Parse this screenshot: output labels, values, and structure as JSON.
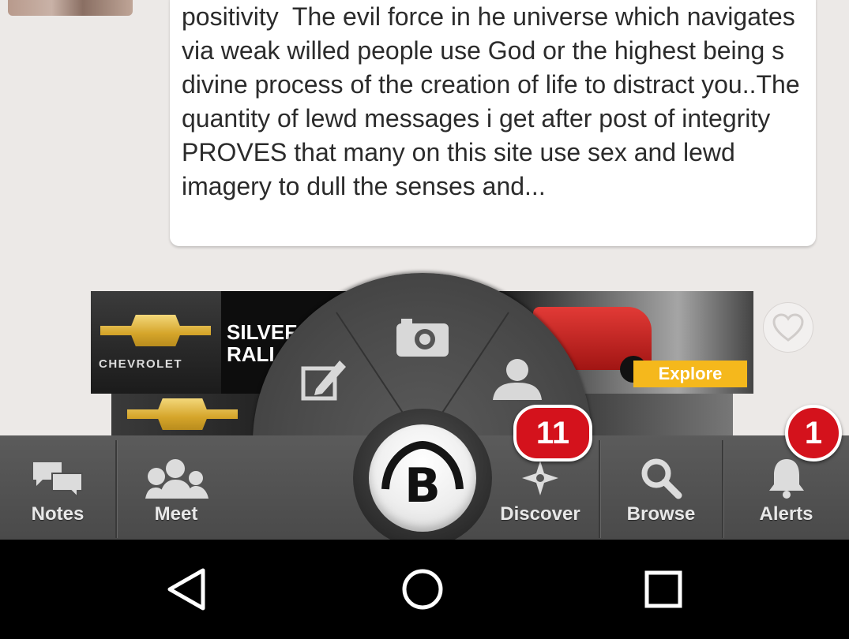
{
  "post": {
    "text": "positivity  The evil force in he universe which navigates via weak willed people use God or the highest being s divine process of the creation of life to distract you..The quantity of lewd messages i get after post of integrity PROVES that many on this site use sex and lewd imagery to dull the senses and..."
  },
  "ad": {
    "brand": "CHEVROLET",
    "headline_line1": "SILVEF",
    "headline_line2": "RALI",
    "cta": "Explore",
    "cta_color": "#f5b81c"
  },
  "radial_menu": {
    "items": [
      {
        "icon": "edit-icon"
      },
      {
        "icon": "camera-icon"
      },
      {
        "icon": "person-icon"
      }
    ]
  },
  "navbar": {
    "items": [
      {
        "label": "Notes",
        "icon": "chat-icon"
      },
      {
        "label": "Meet",
        "icon": "people-icon"
      },
      {
        "label": "Discover",
        "icon": "compass-icon",
        "badge": "11"
      },
      {
        "label": "Browse",
        "icon": "search-icon"
      },
      {
        "label": "Alerts",
        "icon": "bell-icon",
        "badge": "1"
      }
    ],
    "center_logo": "B"
  },
  "system_nav": {
    "buttons": [
      "back-icon",
      "home-icon",
      "recents-icon"
    ]
  },
  "colors": {
    "badge": "#d4121c",
    "navbar": "#4f4f4f",
    "background": "#ece9e7"
  }
}
